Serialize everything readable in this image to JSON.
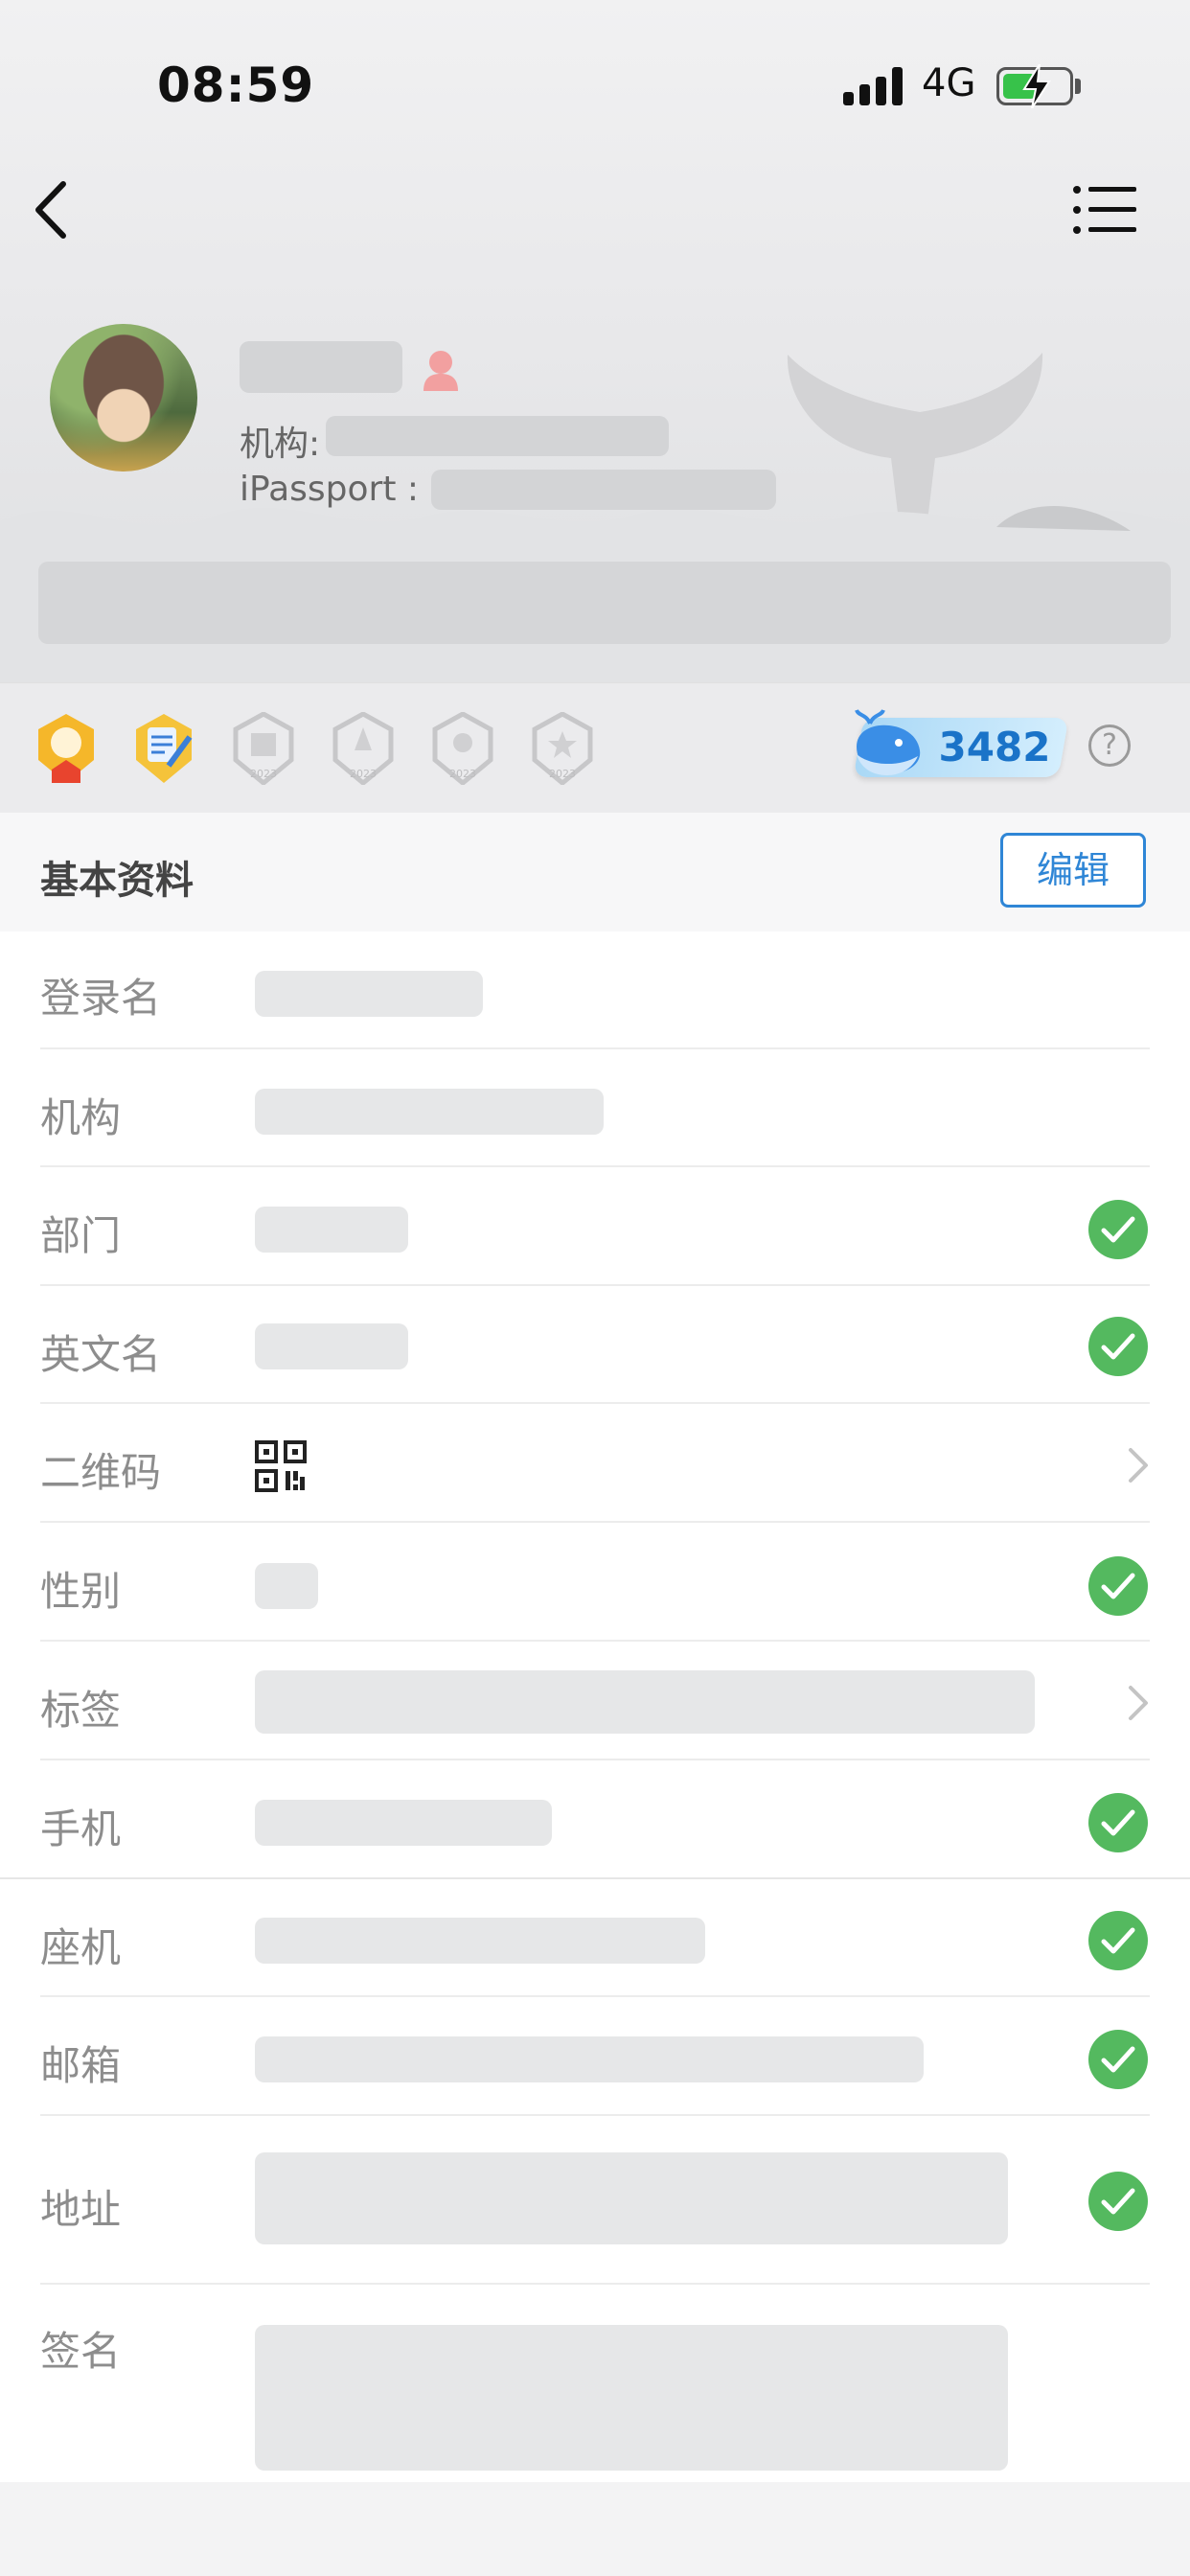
{
  "status_bar": {
    "time": "08:59",
    "network": "4G"
  },
  "nav": {
    "back_icon": "chevron-left-icon",
    "menu_icon": "list-icon"
  },
  "profile": {
    "org_label": "机构:",
    "ipassport_label": "iPassport :"
  },
  "achievements": {
    "badges": [
      "badge-1-icon",
      "badge-2-icon",
      "badge-3-icon",
      "badge-4-icon",
      "badge-5-icon",
      "badge-6-icon"
    ],
    "points": "3482"
  },
  "section": {
    "title": "基本资料",
    "edit_label": "编辑"
  },
  "fields": [
    {
      "label": "登录名"
    },
    {
      "label": "机构"
    },
    {
      "label": "部门"
    },
    {
      "label": "英文名"
    },
    {
      "label": "二维码"
    },
    {
      "label": "性别"
    },
    {
      "label": "标签"
    },
    {
      "label": "手机"
    },
    {
      "label": "座机"
    },
    {
      "label": "邮箱"
    },
    {
      "label": "地址"
    },
    {
      "label": "签名"
    }
  ],
  "colors": {
    "accent": "#2f86d6",
    "verified": "#54b95f",
    "points": "#1a73c8"
  }
}
